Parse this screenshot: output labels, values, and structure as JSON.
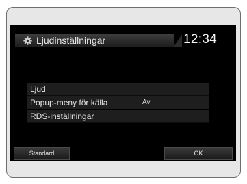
{
  "header": {
    "title": "Ljudinställningar",
    "clock": "12:34",
    "icon": "gear-icon"
  },
  "menu": {
    "items": [
      {
        "label": "Ljud",
        "value": ""
      },
      {
        "label": "Popup-meny för källa",
        "value": "Av"
      },
      {
        "label": "RDS-inställningar",
        "value": ""
      }
    ]
  },
  "buttons": {
    "standard_label": "Standard",
    "ok_label": "OK"
  },
  "colors": {
    "screen_background": "#000000",
    "frame_background": "#e7e7e7",
    "text": "#e6e6e6"
  }
}
